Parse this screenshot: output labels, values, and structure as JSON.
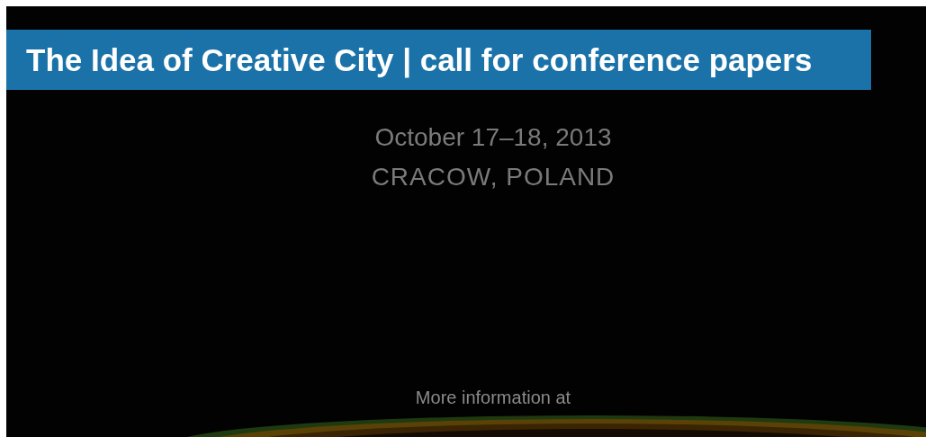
{
  "banner": {
    "title": "The Idea of Creative City | call for conference papers"
  },
  "poster": {
    "kind": "picture",
    "date": "October 17–18, 2013",
    "place": "CRACOW, POLAND",
    "more_info": "More information at"
  }
}
